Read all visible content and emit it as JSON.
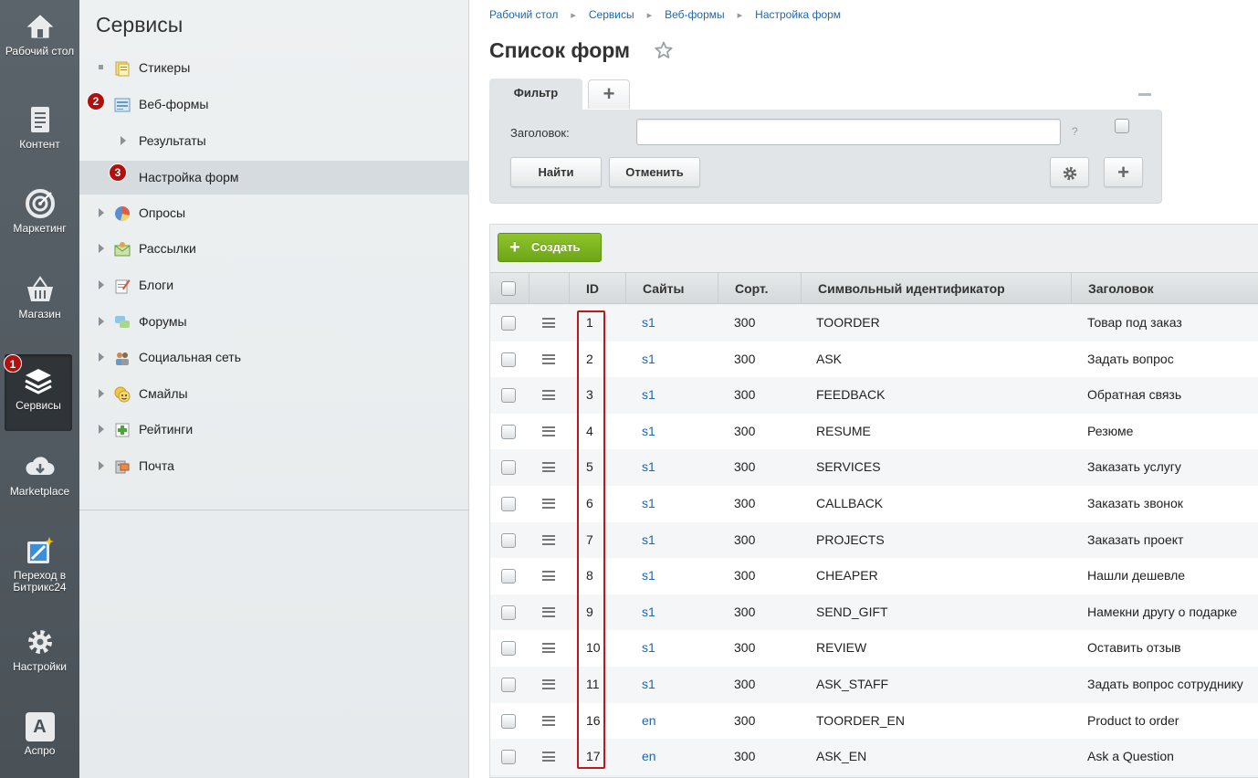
{
  "vmenu": {
    "items": [
      {
        "label": "Рабочий стол",
        "icon": "home-icon"
      },
      {
        "label": "Контент",
        "icon": "document-icon"
      },
      {
        "label": "Маркетинг",
        "icon": "target-icon"
      },
      {
        "label": "Магазин",
        "icon": "basket-icon"
      },
      {
        "label": "Сервисы",
        "icon": "layers-icon",
        "badge": "1"
      },
      {
        "label": "Marketplace",
        "icon": "cloud-icon"
      },
      {
        "label": "Переход в Битрикс24",
        "icon": "magic-icon"
      },
      {
        "label": "Настройки",
        "icon": "gear-icon"
      },
      {
        "label": "Аспро",
        "icon": "aspro-icon",
        "glyph": "A"
      }
    ]
  },
  "spanel": {
    "title": "Сервисы",
    "items": [
      {
        "label": "Стикеры"
      },
      {
        "label": "Веб-формы",
        "badge": "2"
      },
      {
        "label": "Результаты"
      },
      {
        "label": "Настройка форм",
        "badge": "3"
      },
      {
        "label": "Опросы"
      },
      {
        "label": "Рассылки"
      },
      {
        "label": "Блоги"
      },
      {
        "label": "Форумы"
      },
      {
        "label": "Социальная сеть"
      },
      {
        "label": "Смайлы"
      },
      {
        "label": "Рейтинги"
      },
      {
        "label": "Почта"
      }
    ]
  },
  "breadcrumbs": [
    "Рабочий стол",
    "Сервисы",
    "Веб-формы",
    "Настройка форм"
  ],
  "page": {
    "title": "Список форм"
  },
  "filter": {
    "tab_label": "Фильтр",
    "add_tab": "+",
    "field_label": "Заголовок:",
    "field_value": "",
    "help": "?",
    "find_label": "Найти",
    "cancel_label": "Отменить",
    "add_label": "+"
  },
  "list": {
    "create_label": "Создать",
    "create_plus": "+",
    "columns": [
      "ID",
      "Сайты",
      "Сорт.",
      "Символьный идентификатор",
      "Заголовок"
    ],
    "rows": [
      {
        "id": "1",
        "site": "s1",
        "sort": "300",
        "code": "TOORDER",
        "title": "Товар под заказ"
      },
      {
        "id": "2",
        "site": "s1",
        "sort": "300",
        "code": "ASK",
        "title": "Задать вопрос"
      },
      {
        "id": "3",
        "site": "s1",
        "sort": "300",
        "code": "FEEDBACK",
        "title": "Обратная связь"
      },
      {
        "id": "4",
        "site": "s1",
        "sort": "300",
        "code": "RESUME",
        "title": "Резюме"
      },
      {
        "id": "5",
        "site": "s1",
        "sort": "300",
        "code": "SERVICES",
        "title": "Заказать услугу"
      },
      {
        "id": "6",
        "site": "s1",
        "sort": "300",
        "code": "CALLBACK",
        "title": "Заказать звонок"
      },
      {
        "id": "7",
        "site": "s1",
        "sort": "300",
        "code": "PROJECTS",
        "title": "Заказать проект"
      },
      {
        "id": "8",
        "site": "s1",
        "sort": "300",
        "code": "CHEAPER",
        "title": "Нашли дешевле"
      },
      {
        "id": "9",
        "site": "s1",
        "sort": "300",
        "code": "SEND_GIFT",
        "title": "Намекни другу о подарке"
      },
      {
        "id": "10",
        "site": "s1",
        "sort": "300",
        "code": "REVIEW",
        "title": "Оставить отзыв"
      },
      {
        "id": "11",
        "site": "s1",
        "sort": "300",
        "code": "ASK_STAFF",
        "title": "Задать вопрос сотруднику"
      },
      {
        "id": "16",
        "site": "en",
        "sort": "300",
        "code": "TOORDER_EN",
        "title": "Product to order"
      },
      {
        "id": "17",
        "site": "en",
        "sort": "300",
        "code": "ASK_EN",
        "title": "Ask a Question"
      }
    ]
  },
  "colors": {
    "accent": "#2067b0",
    "badge": "#b40f0f",
    "create": "#7ab320",
    "highlight": "#c0161d"
  }
}
